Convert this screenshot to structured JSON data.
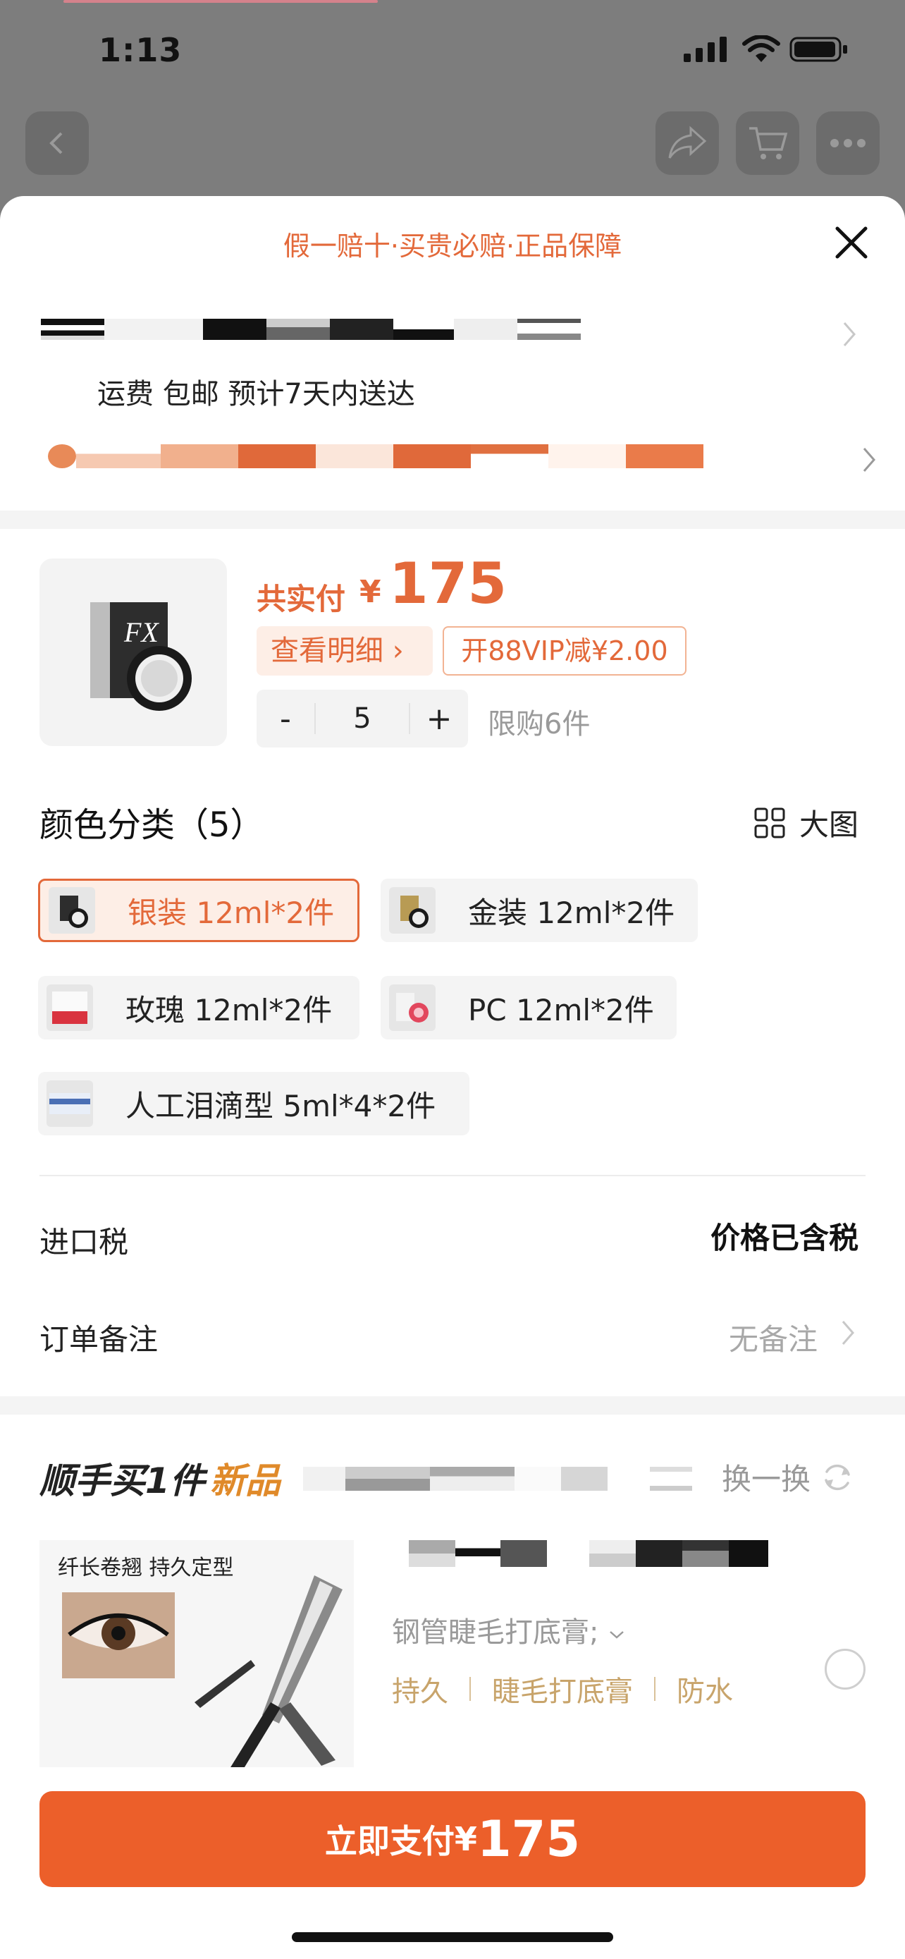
{
  "status_bar": {
    "time": "1:13"
  },
  "header": {
    "back_icon": "chevron-left-icon",
    "share_icon": "share-icon",
    "cart_icon": "cart-icon",
    "more_icon": "more-icon"
  },
  "sheet": {
    "guarantee": "假一赔十·买贵必赔·正品保障",
    "shipping": "运费 包邮 预计7天内送达"
  },
  "product": {
    "total_label": "共实付",
    "currency": "¥",
    "total_value": "175",
    "detail_label": "查看明细 ›",
    "vip_label": "开88VIP减¥2.00",
    "minus": "-",
    "quantity": "5",
    "plus": "+",
    "limit": "限购6件"
  },
  "variants": {
    "title": "颜色分类（5）",
    "big_image_label": "大图",
    "options": [
      {
        "label": "银装 12ml*2件",
        "selected": true
      },
      {
        "label": "金装 12ml*2件",
        "selected": false
      },
      {
        "label": "玫瑰 12ml*2件",
        "selected": false
      },
      {
        "label": "PC 12ml*2件",
        "selected": false
      },
      {
        "label": "人工泪滴型 5ml*4*2件",
        "selected": false
      }
    ]
  },
  "rows": {
    "tax_label": "进口税",
    "tax_value": "价格已含税",
    "note_label": "订单备注",
    "note_value": "无备注"
  },
  "addon": {
    "title": "顺手买1件",
    "new_label": "新品",
    "refresh_label": "换一换",
    "image_caption": "纤长卷翘 持久定型",
    "subtitle": "钢管睫毛打底膏;",
    "tags": [
      "持久",
      "睫毛打底膏",
      "防水"
    ]
  },
  "footer": {
    "pay_label": "立即支付",
    "pay_currency": "¥",
    "pay_value": "175"
  },
  "colors": {
    "accent": "#e3693a",
    "pay_button": "#ec5f2a",
    "tag_gold": "#c8a46b"
  }
}
